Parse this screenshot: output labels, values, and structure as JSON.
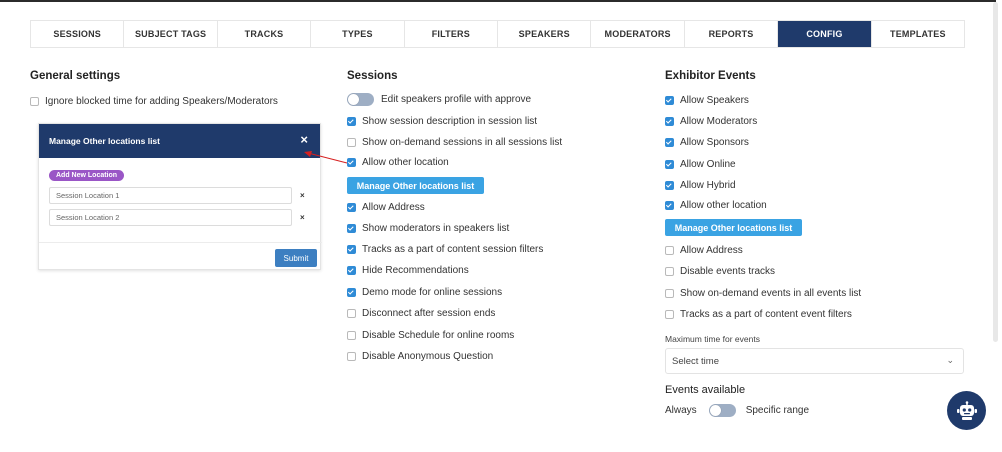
{
  "tabs": [
    {
      "label": "SESSIONS"
    },
    {
      "label": "SUBJECT TAGS"
    },
    {
      "label": "TRACKS"
    },
    {
      "label": "TYPES"
    },
    {
      "label": "FILTERS"
    },
    {
      "label": "SPEAKERS"
    },
    {
      "label": "MODERATORS"
    },
    {
      "label": "REPORTS"
    },
    {
      "label": "CONFIG",
      "active": true
    },
    {
      "label": "TEMPLATES"
    }
  ],
  "general": {
    "title": "General settings",
    "ignore_blocked": {
      "label": "Ignore blocked time for adding Speakers/Moderators",
      "checked": false
    }
  },
  "modal": {
    "title": "Manage Other locations list",
    "close_glyph": "×",
    "add_button": "Add New Location",
    "locations": [
      "Session Location 1",
      "Session Location 2"
    ],
    "remove_glyph": "×",
    "submit": "Submit"
  },
  "sessions": {
    "title": "Sessions",
    "toggle_label": "Edit speakers profile with approve",
    "items": [
      {
        "label": "Show session description in session list",
        "checked": true
      },
      {
        "label": "Show on-demand sessions in all sessions list",
        "checked": false
      },
      {
        "label": "Allow other location",
        "checked": true
      },
      {
        "label": "Allow Address",
        "checked": true
      },
      {
        "label": "Show moderators in speakers list",
        "checked": true
      },
      {
        "label": "Tracks as a part of content session filters",
        "checked": true
      },
      {
        "label": "Hide Recommendations",
        "checked": true
      },
      {
        "label": "Demo mode for online sessions",
        "checked": true
      },
      {
        "label": "Disconnect after session ends",
        "checked": false
      },
      {
        "label": "Disable Schedule for online rooms",
        "checked": false
      },
      {
        "label": "Disable Anonymous Question",
        "checked": false
      }
    ],
    "manage_button": "Manage Other locations list"
  },
  "exhibitor": {
    "title": "Exhibitor Events",
    "items": [
      {
        "label": "Allow Speakers",
        "checked": true
      },
      {
        "label": "Allow Moderators",
        "checked": true
      },
      {
        "label": "Allow Sponsors",
        "checked": true
      },
      {
        "label": "Allow Online",
        "checked": true
      },
      {
        "label": "Allow Hybrid",
        "checked": true
      },
      {
        "label": "Allow other location",
        "checked": true
      },
      {
        "label": "Allow Address",
        "checked": false
      },
      {
        "label": "Disable events tracks",
        "checked": false
      },
      {
        "label": "Show on-demand events in all events list",
        "checked": false
      },
      {
        "label": "Tracks as a part of content event filters",
        "checked": false
      }
    ],
    "manage_button": "Manage Other locations list",
    "max_time_label": "Maximum time for events",
    "max_time_value": "Select time",
    "chevron_glyph": "⌄",
    "events_available_title": "Events available",
    "always_label": "Always",
    "specific_label": "Specific range"
  },
  "colors": {
    "accent": "#1f3a6b",
    "blue_button": "#3aa3e3",
    "purple": "#9a56c6",
    "check": "#2f8bd6"
  }
}
